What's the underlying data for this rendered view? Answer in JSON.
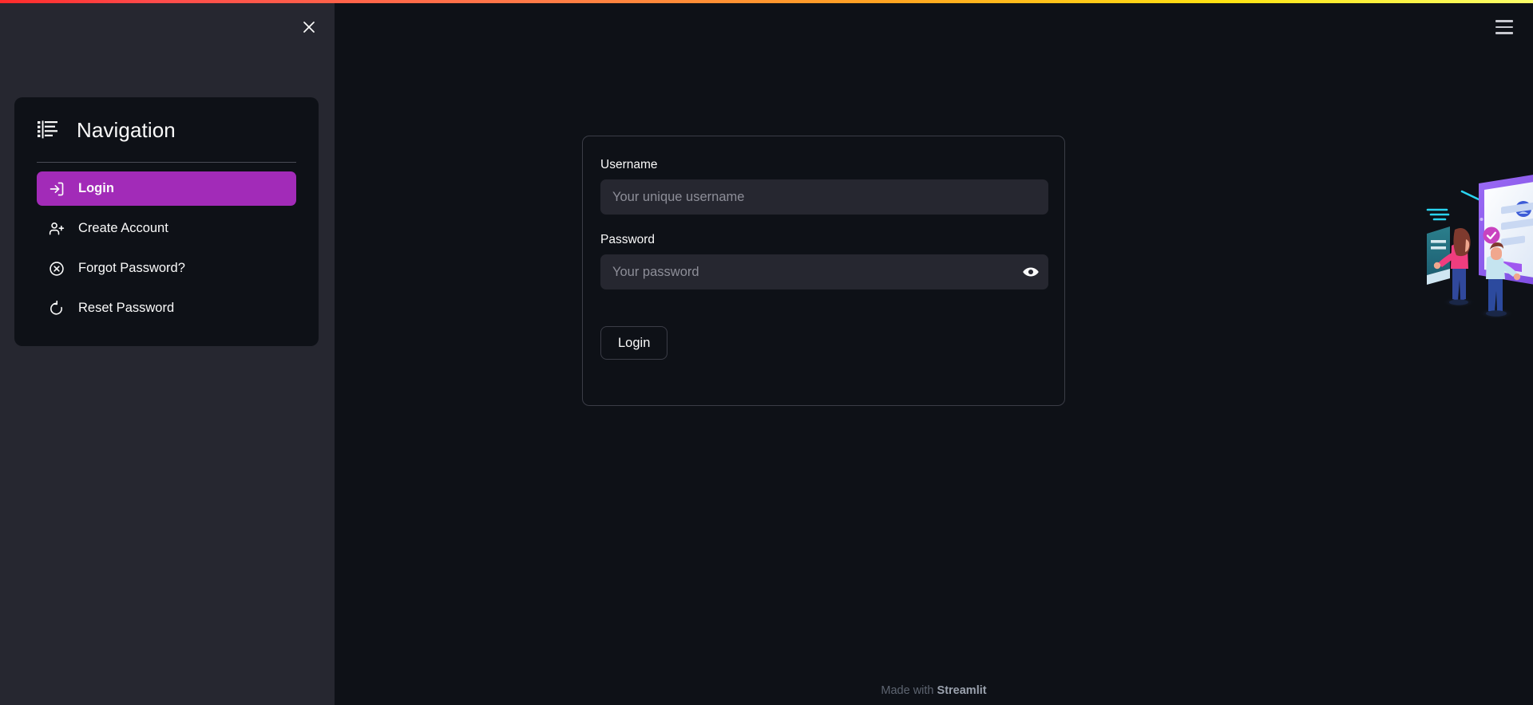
{
  "theme": {
    "sidebar_bg": "#262730",
    "main_bg": "#0E1117",
    "accent_purple": "#A22BB8",
    "input_bg": "#262730",
    "text": "#FAFAFA",
    "muted_text": "#8d8e98",
    "border": "#3b3d47",
    "gradient_from": "#FF2B2B",
    "gradient_to": "#FAFF69"
  },
  "sidebar": {
    "close_label": "×",
    "nav_title": "Navigation",
    "header_icon": "list-menu-icon",
    "items": [
      {
        "label": "Login",
        "icon": "login-arrow-icon",
        "active": true
      },
      {
        "label": "Create Account",
        "icon": "person-add-icon",
        "active": false
      },
      {
        "label": "Forgot Password?",
        "icon": "circle-x-icon",
        "active": false
      },
      {
        "label": "Reset Password",
        "icon": "rotate-ccw-icon",
        "active": false
      }
    ]
  },
  "header": {
    "menu_icon": "hamburger-menu-icon"
  },
  "login_form": {
    "username_label": "Username",
    "username_placeholder": "Your unique username",
    "username_value": "",
    "password_label": "Password",
    "password_placeholder": "Your password",
    "password_value": "",
    "password_toggle_icon": "eye-icon",
    "submit_label": "Login"
  },
  "illustration": {
    "name": "login-illustration",
    "description": "Two people at a large login screen"
  },
  "footer": {
    "made_with": "Made with ",
    "brand": "Streamlit"
  }
}
